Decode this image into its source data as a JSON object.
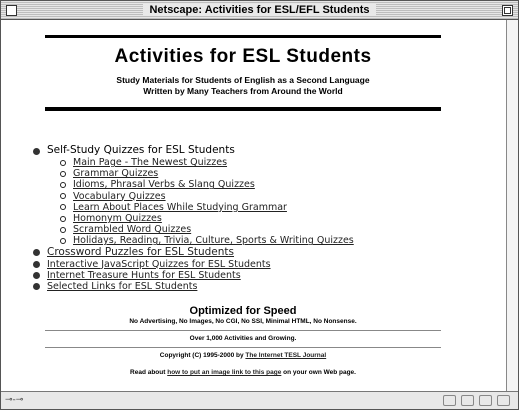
{
  "window": {
    "title": "Netscape: Activities for ESL/EFL Students"
  },
  "banner": {
    "title": "Activities for ESL Students",
    "subtitle_line1": "Study Materials for Students of English as a Second Language",
    "subtitle_line2": "Written by Many Teachers from Around the World"
  },
  "menu": {
    "self_study": "Self-Study Quizzes for ESL Students",
    "sub_items": [
      "Main Page - The Newest Quizzes",
      "Grammar Quizzes",
      "Idioms, Phrasal Verbs & Slang Quizzes",
      "Vocabulary Quizzes",
      "Learn About Places While Studying Grammar",
      "Homonym Quizzes",
      "Scrambled Word Quizzes",
      "Holidays, Reading, Trivia, Culture, Sports & Writing Quizzes"
    ],
    "top_links": [
      "Crossword Puzzles for ESL Students",
      "Interactive JavaScript Quizzes for ESL Students",
      "Internet Treasure Hunts for ESL Students",
      "Selected Links for ESL Students"
    ]
  },
  "footer": {
    "optimized_title": "Optimized for Speed",
    "optimized_sub": "No Advertising, No Images, No CGI, No SSI, Minimal HTML, No Nonsense.",
    "activities": "Over 1,000 Activities and Growing.",
    "copyright_prefix": "Copyright (C) 1995-2000 by ",
    "copyright_link": "The Internet TESL Journal",
    "read_prefix": "Read about ",
    "read_link": "how to put an image link to this page",
    "read_suffix": " on your own Web page."
  }
}
